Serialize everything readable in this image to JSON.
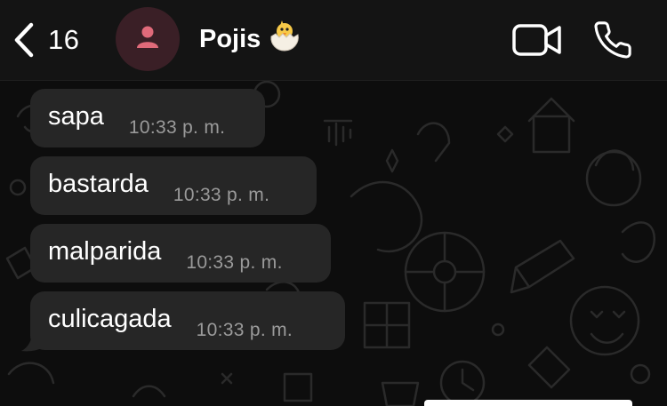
{
  "header": {
    "back_icon": "chevron-left-icon",
    "unread_count": "16",
    "avatar_icon": "person-icon",
    "contact_name": "Pojis",
    "contact_emoji": "🐣",
    "video_icon": "video-camera-icon",
    "call_icon": "phone-icon"
  },
  "messages": [
    {
      "text": "sapa",
      "time": "10:33 p. m."
    },
    {
      "text": "bastarda",
      "time": "10:33 p. m."
    },
    {
      "text": "malparida",
      "time": "10:33 p. m."
    },
    {
      "text": "culicagada",
      "time": "10:33 p. m."
    }
  ],
  "colors": {
    "header_bg": "#141414",
    "chat_bg": "#0d0d0d",
    "bubble_bg": "#262626",
    "avatar_bg": "#3a1f26",
    "avatar_icon": "#e06a7a",
    "time_text": "#9a9a9a"
  }
}
